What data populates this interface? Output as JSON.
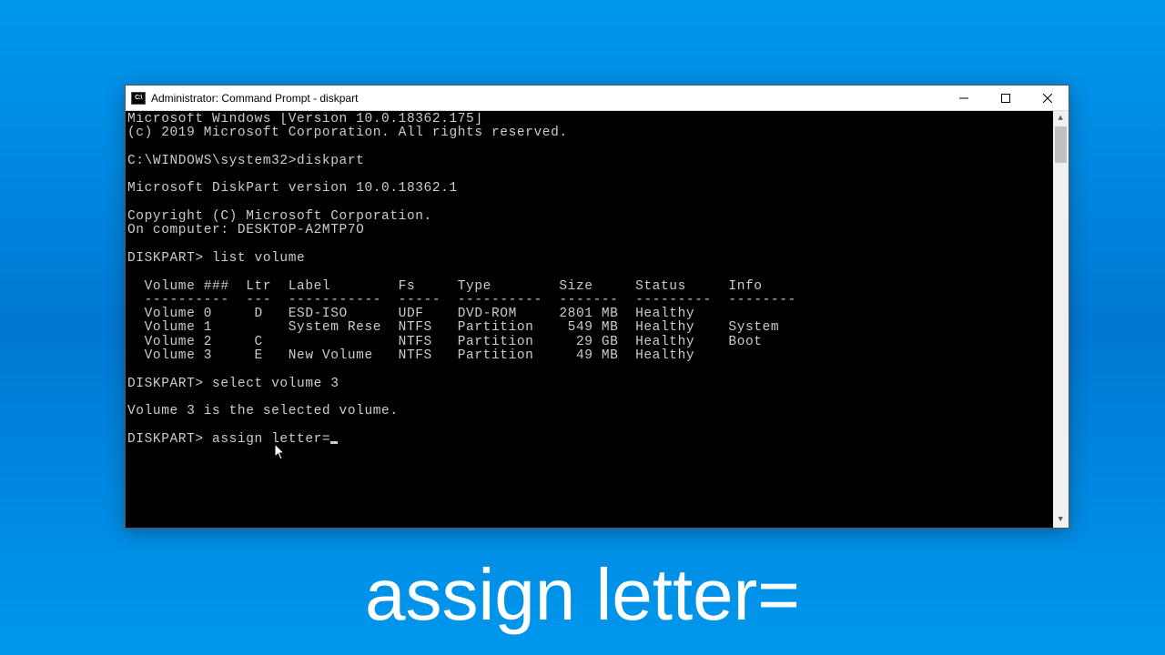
{
  "window": {
    "title": "Administrator: Command Prompt - diskpart"
  },
  "console": {
    "banner1": "Microsoft Windows [Version 10.0.18362.175]",
    "banner2": "(c) 2019 Microsoft Corporation. All rights reserved.",
    "prompt1_path": "C:\\WINDOWS\\system32>",
    "prompt1_cmd": "diskpart",
    "dp_banner": "Microsoft DiskPart version 10.0.18362.1",
    "dp_copyright": "Copyright (C) Microsoft Corporation.",
    "dp_computer": "On computer: DESKTOP-A2MTP7O",
    "dp_prompt": "DISKPART> ",
    "cmd_list": "list volume",
    "cmd_select": "select volume 3",
    "select_response": "Volume 3 is the selected volume.",
    "cmd_assign": "assign letter=",
    "table": {
      "header": "  Volume ###  Ltr  Label        Fs     Type        Size     Status     Info",
      "divider": "  ----------  ---  -----------  -----  ----------  -------  ---------  --------",
      "rows": [
        "  Volume 0     D   ESD-ISO      UDF    DVD-ROM     2801 MB  Healthy",
        "  Volume 1         System Rese  NTFS   Partition    549 MB  Healthy    System",
        "  Volume 2     C                NTFS   Partition     29 GB  Healthy    Boot",
        "  Volume 3     E   New Volume   NTFS   Partition     49 MB  Healthy"
      ]
    }
  },
  "caption": "assign letter="
}
